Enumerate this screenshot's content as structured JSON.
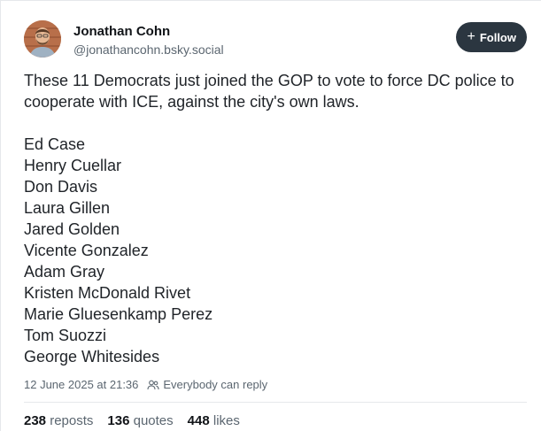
{
  "author": {
    "name": "Jonathan Cohn",
    "handle": "@jonathancohn.bsky.social"
  },
  "follow_label": "Follow",
  "post": {
    "text": "These 11 Democrats just joined the GOP to vote to force DC police to cooperate with ICE, against the city's own laws.",
    "names": [
      "Ed Case",
      "Henry Cuellar",
      "Don Davis",
      "Laura Gillen",
      "Jared Golden",
      "Vicente Gonzalez",
      "Adam Gray",
      "Kristen McDonald Rivet",
      "Marie Gluesenkamp Perez",
      "Tom Suozzi",
      "George Whitesides"
    ]
  },
  "meta": {
    "timestamp": "12 June 2025 at 21:36",
    "reply_setting": "Everybody can reply"
  },
  "stats": {
    "reposts_count": "238",
    "reposts_label": "reposts",
    "quotes_count": "136",
    "quotes_label": "quotes",
    "likes_count": "448",
    "likes_label": "likes"
  },
  "colors": {
    "follow_bg": "#2b3640",
    "muted_text": "#5b6670",
    "divider": "#e6e8eb"
  },
  "icons": {
    "follow": "plus-icon",
    "reply_setting": "people-icon"
  }
}
